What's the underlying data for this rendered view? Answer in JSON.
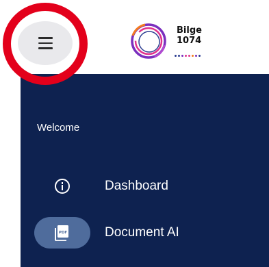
{
  "logo": {
    "line1": "Bilge",
    "line2": "1074",
    "ring_colors": [
      "#7b2fbe",
      "#e0318c",
      "#f47b20",
      "#2c3e91"
    ]
  },
  "header": {
    "menu_icon": "hamburger-menu-icon",
    "highlight_color": "#e3001b"
  },
  "sidebar": {
    "background": "#0e2250",
    "welcome": "Welcome",
    "items": [
      {
        "label": "Dashboard",
        "icon": "info-circle-icon",
        "active": false
      },
      {
        "label": "Document AI",
        "icon": "pdf-file-icon",
        "active": true
      }
    ]
  }
}
